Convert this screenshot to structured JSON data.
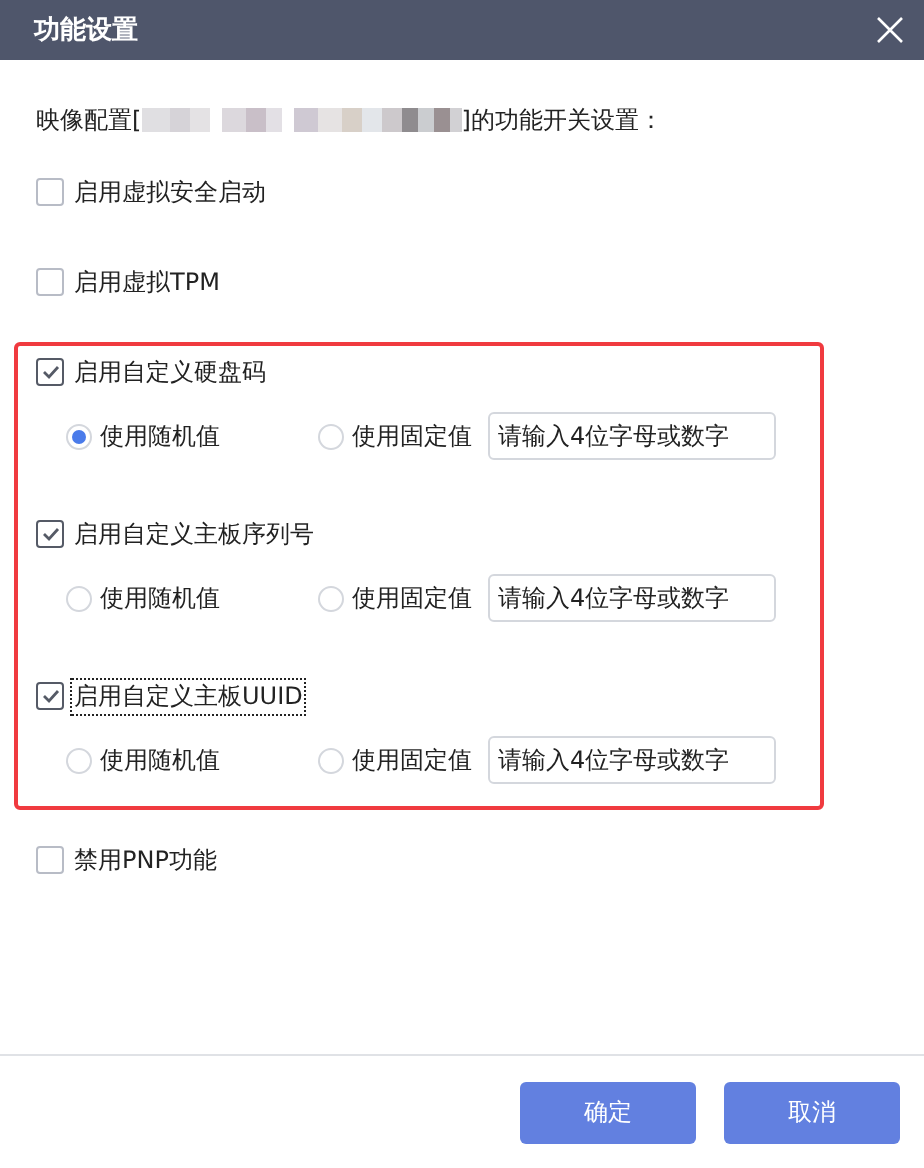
{
  "dialog": {
    "title": "功能设置"
  },
  "intro": {
    "before": "映像配置[",
    "after": "]的功能开关设置："
  },
  "options": [
    {
      "label": "启用虚拟安全启动",
      "checked": false
    },
    {
      "label": "启用虚拟TPM",
      "checked": false
    }
  ],
  "highlighted_options": [
    {
      "label": "启用自定义硬盘码",
      "checked": true,
      "focused": false,
      "choices": [
        {
          "label": "使用随机值",
          "selected": true
        },
        {
          "label": "使用固定值",
          "selected": false
        }
      ],
      "input": {
        "placeholder": "请输入4位字母或数字"
      }
    },
    {
      "label": "启用自定义主板序列号",
      "checked": true,
      "focused": false,
      "choices": [
        {
          "label": "使用随机值",
          "selected": false
        },
        {
          "label": "使用固定值",
          "selected": false
        }
      ],
      "input": {
        "placeholder": "请输入4位字母或数字"
      }
    },
    {
      "label": "启用自定义主板UUID",
      "checked": true,
      "focused": true,
      "choices": [
        {
          "label": "使用随机值",
          "selected": false
        },
        {
          "label": "使用固定值",
          "selected": false
        }
      ],
      "input": {
        "placeholder": "请输入4位字母或数字"
      }
    }
  ],
  "bottom_options": [
    {
      "label": "禁用PNP功能",
      "checked": false
    }
  ],
  "buttons": [
    {
      "label": "确定"
    },
    {
      "label": "取消"
    }
  ]
}
